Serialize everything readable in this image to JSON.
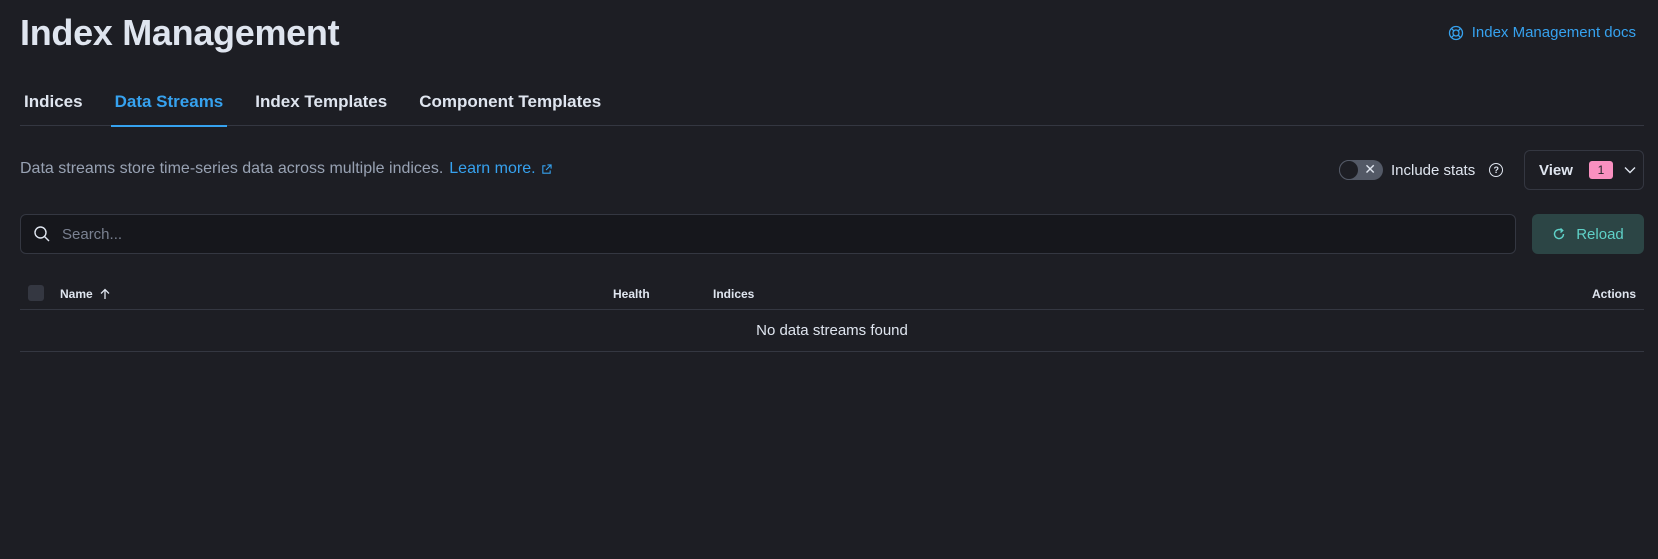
{
  "header": {
    "title": "Index Management",
    "docs_link": "Index Management docs"
  },
  "tabs": [
    {
      "label": "Indices",
      "active": false
    },
    {
      "label": "Data Streams",
      "active": true
    },
    {
      "label": "Index Templates",
      "active": false
    },
    {
      "label": "Component Templates",
      "active": false
    }
  ],
  "description": {
    "text": "Data streams store time-series data across multiple indices.",
    "learn_more": "Learn more."
  },
  "include_stats": {
    "label": "Include stats",
    "enabled": false
  },
  "view_button": {
    "label": "View",
    "badge": "1"
  },
  "search": {
    "placeholder": "Search..."
  },
  "reload_button": {
    "label": "Reload"
  },
  "table": {
    "columns": {
      "name": "Name",
      "health": "Health",
      "indices": "Indices",
      "actions": "Actions"
    },
    "sort": {
      "column": "Name",
      "direction": "ascending"
    },
    "empty_message": "No data streams found"
  },
  "colors": {
    "background": "#1d1e24",
    "accent": "#36a2ef",
    "badge": "#f990c0",
    "reload_text": "#5fd1c8"
  },
  "icons": [
    "help-circle-icon",
    "external-link-icon",
    "question-icon",
    "chevron-down-icon",
    "search-icon",
    "refresh-icon",
    "arrow-up-icon"
  ]
}
